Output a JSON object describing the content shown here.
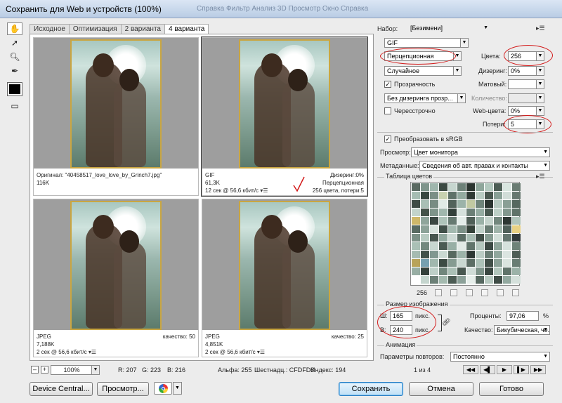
{
  "window": {
    "title": "Сохранить для Web и устройств (100%)",
    "menu_ghost": "Справка   Фильтр   Анализ   3D   Просмотр   Окно   Справка"
  },
  "toolbox": {
    "tools": [
      "hand-tool",
      "slice-select-tool",
      "zoom-tool",
      "eyedropper-tool"
    ],
    "swatch_color": "#000000"
  },
  "tabs": [
    "Исходное",
    "Оптимизация",
    "2 варианта",
    "4 варианта"
  ],
  "active_tab": 3,
  "preview": {
    "cells": [
      {
        "line1": "Оригинал: \"40458517_love_love_by_Grinch7.jpg\"",
        "line2": "116K",
        "line3": "",
        "r1": "",
        "r2": "",
        "r3": ""
      },
      {
        "line1": "GIF",
        "line2": "61,3K",
        "line3": "12 сек @ 56,6 кбит/с",
        "r1": "Дизеринг:0%",
        "r2": "Перцепционная",
        "r3": "256 цвета, потери:5"
      },
      {
        "line1": "JPEG",
        "line2": "7,188K",
        "line3": "2 сек @ 56,6 кбит/с",
        "r1": "качество: 50",
        "r2": "",
        "r3": ""
      },
      {
        "line1": "JPEG",
        "line2": "4,851K",
        "line3": "2 сек @ 56,6 кбит/с",
        "r1": "качество: 25",
        "r2": "",
        "r3": ""
      }
    ],
    "cell_menu": "▾☰"
  },
  "status": {
    "zoom": "100%",
    "minus": "–",
    "plus": "+",
    "r": "R: 207",
    "g": "G: 223",
    "b": "B: 216",
    "alpha": "Альфа: 255",
    "hex": "Шестнадц.: CFDFD8",
    "index": "Индекс: 194"
  },
  "settings": {
    "preset_label": "Набор:",
    "preset_value": "[Безимени]",
    "format": "GIF",
    "reduction": "Перцепционная",
    "colors_label": "Цвета:",
    "colors_value": "256",
    "dither_algo": "Случайное",
    "dither_label": "Дизеринг:",
    "dither_value": "0%",
    "transparency_label": "Прозрачность",
    "transparency_checked": true,
    "matte_label": "Матовый:",
    "matte_value": "",
    "trans_dither": "Без дизеринга прозр...",
    "amount_label": "Количество:",
    "amount_value": "",
    "interlaced_label": "Чересстрочно",
    "interlaced_checked": false,
    "websnap_label": "Web-цвета:",
    "websnap_value": "0%",
    "lossy_label": "Потери:",
    "lossy_value": "5",
    "srgb_label": "Преобразовать в sRGB",
    "srgb_checked": true,
    "preview_label": "Просмотр:",
    "preview_value": "Цвет монитора",
    "metadata_label": "Метаданные:",
    "metadata_value": "Сведения об авт. правах и контакты"
  },
  "color_table": {
    "title": "Таблица цветов",
    "count": "256",
    "colors": [
      "#5a6a62",
      "#7f958c",
      "#9fb6ad",
      "#3c4a43",
      "#c6d6cf",
      "#6d8178",
      "#2b3530",
      "#8ea69b",
      "#b3c9bf",
      "#4d5e56",
      "#d9e6e0",
      "#6a7c73",
      "#a5bcb2",
      "#394640",
      "#7a8f86",
      "#c8d2b0",
      "#5e7168",
      "#93aaa0",
      "#2f3a35",
      "#b9ccc3",
      "#48574f",
      "#88a096",
      "#d1ddd8",
      "#667870",
      "#3e4c45",
      "#a9bfb5",
      "#788c83",
      "#e0ebe6",
      "#52625a",
      "#9cb3a9",
      "#c1c9a2",
      "#6f847a",
      "#2a332f",
      "#b6c9c0",
      "#8a9f95",
      "#56685f",
      "#c3d4cc",
      "#445249",
      "#7e948a",
      "#a0b7ad",
      "#33403a",
      "#d5e1dc",
      "#6b7f76",
      "#95ac a2",
      "#4a5a52",
      "#bdd0c7",
      "#82988e",
      "#5f7369",
      "#cfb86a",
      "#8fa59b",
      "#3a4742",
      "#aec3b9",
      "#667a71",
      "#e4ede9",
      "#4f5f57",
      "#9ab1a7",
      "#c4d3cc",
      "#72877d",
      "#2d3733",
      "#b0c5bb",
      "#596b62",
      "#8ca298",
      "#d8e3de",
      "#415049",
      "#a3b9af",
      "#7c9187",
      "#354239",
      "#c0d1c9",
      "#687c73",
      "#9fb4aa",
      "#50615a",
      "#e8d184",
      "#7b9086",
      "#b8cbc2",
      "#46554e",
      "#92a99f",
      "#cdd9d4",
      "#5b6d64",
      "#a8bdb3",
      "#3f4d46",
      "#879d93",
      "#d2dfd9",
      "#647770",
      "#30393a",
      "#aac0b6",
      "#74897f",
      "#c7d7d0",
      "#4b5b53",
      "#98afa5",
      "#e2eae6",
      "#61746b",
      "#b4c7be",
      "#3b4843",
      "#8ea49a",
      "#d6e2dd",
      "#6e8379",
      "#a6bbb1",
      "#43514a",
      "#819790",
      "#cad9d2",
      "#57695f",
      "#9db3a9",
      "#2e3834",
      "#bccdc5",
      "#6a7e75",
      "#90a79d",
      "#dbe5e1",
      "#4e5e56",
      "#b8a35a",
      "#77a0b0",
      "#a1b8ae",
      "#3d4b44",
      "#859b91",
      "#c9d8d1",
      "#5c6e65",
      "#adc2b8",
      "#414f48",
      "#8b a197",
      "#dae4df",
      "#697d74",
      "#98aea4",
      "#34403b",
      "#bed0c8",
      "#71867c",
      "#abc0b6",
      "#485850",
      "#d0dcd7",
      "#7f958b",
      "#3a4741",
      "#b2c6bc",
      "#60736a",
      "#9bb2a8",
      "#ffffff",
      "#c5d5ce",
      "#6c8077",
      "#a4baaf",
      "#4c5c54",
      "#8ca199",
      "#e6eeea",
      "#566860",
      "#b7c9c0",
      "#3f4c46",
      "#93a9a0",
      "#d4e0db"
    ]
  },
  "image_size": {
    "title": "Размер изображения",
    "w_label": "Ш:",
    "w_value": "165",
    "w_unit": "пикс.",
    "h_label": "В:",
    "h_value": "240",
    "h_unit": "пикс.",
    "percent_label": "Проценты:",
    "percent_value": "97,06",
    "percent_unit": "%",
    "quality_label": "Качество:",
    "quality_value": "Бикубическая, че..."
  },
  "animation": {
    "title": "Анимация",
    "loop_label": "Параметры повторов:",
    "loop_value": "Постоянно",
    "frame": "1 из 4"
  },
  "buttons": {
    "device_central": "Device Central...",
    "preview": "Просмотр...",
    "save": "Сохранить",
    "cancel": "Отмена",
    "done": "Готово"
  }
}
